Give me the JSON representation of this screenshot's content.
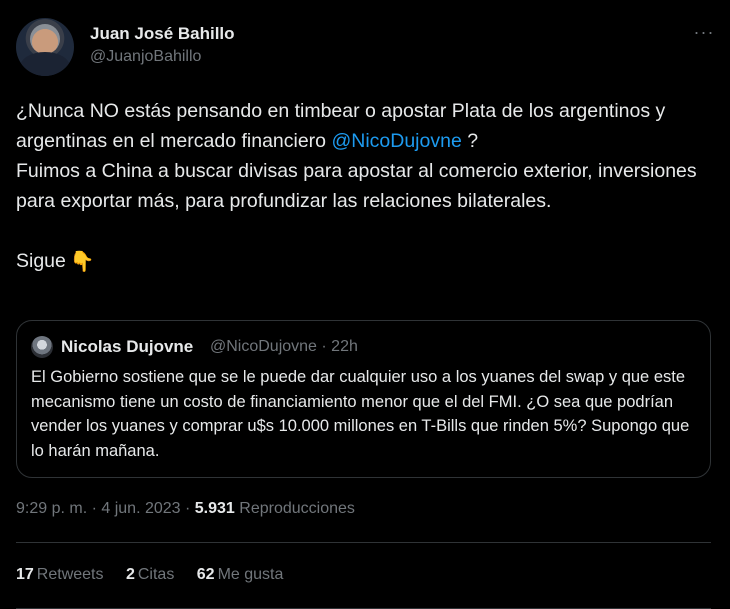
{
  "author": {
    "name": "Juan José Bahillo",
    "handle": "@JuanjoBahillo"
  },
  "more_label": "···",
  "tweet": {
    "line1_pre": "¿Nunca NO estás pensando en timbear o apostar Plata de los argentinos y argentinas en el mercado financiero ",
    "line1_mention": "@NicoDujovne",
    "line1_post": " ?",
    "line2": "Fuimos a China a buscar divisas para apostar al comercio exterior, inversiones para exportar más, para profundizar las relaciones bilaterales.",
    "line3": "Sigue",
    "emoji": "👇"
  },
  "quote": {
    "name": "Nicolas Dujovne",
    "handle_time": "@NicoDujovne · 22h",
    "text": "El Gobierno sostiene que se le puede dar cualquier uso a los yuanes del swap y que este mecanismo tiene un costo de financiamiento menor que el del FMI. ¿O sea que podrían vender los yuanes y comprar u$s 10.000 millones en T-Bills que rinden 5%? Supongo que lo harán mañana."
  },
  "meta": {
    "time_date": "9:29 p. m. · 4 jun. 2023 · ",
    "views_count": "5.931",
    "views_label": " Reproducciones"
  },
  "stats": {
    "retweets_count": "17",
    "retweets_label": "Retweets",
    "quotes_count": "2",
    "quotes_label": "Citas",
    "likes_count": "62",
    "likes_label": "Me gusta"
  },
  "colors": {
    "background": "#000000",
    "text": "#e7e9ea",
    "secondary": "#71767b",
    "link": "#1d9bf0",
    "border": "#2f3336"
  }
}
